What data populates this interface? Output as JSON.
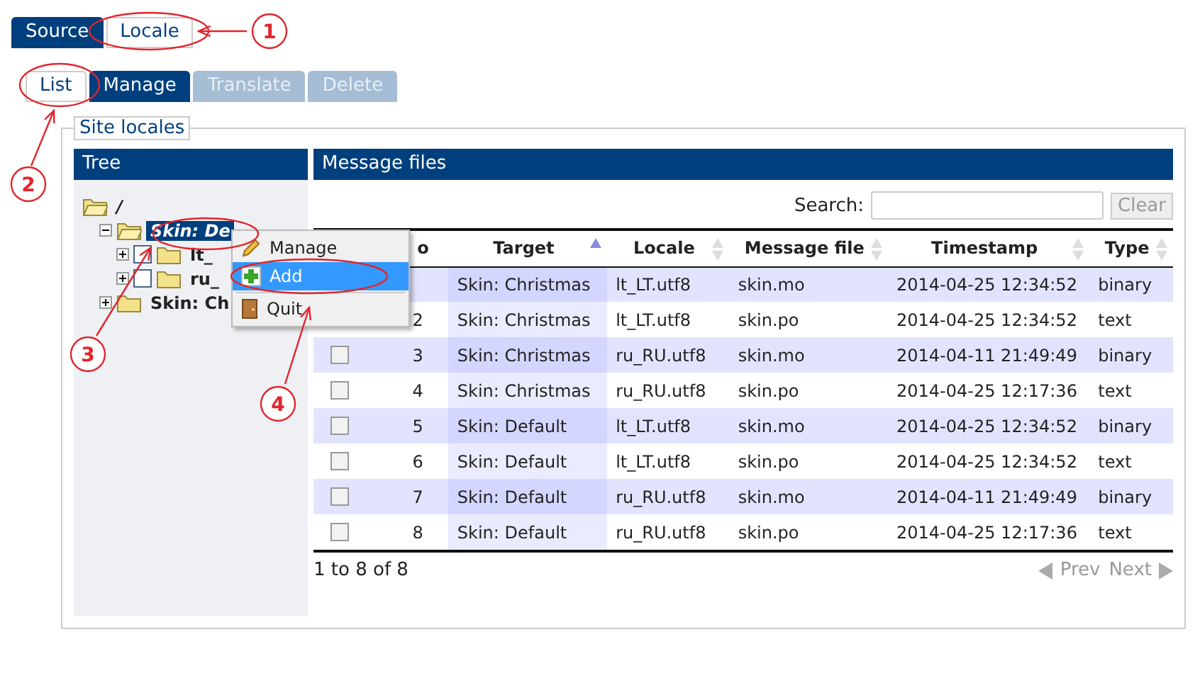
{
  "top_tabs": [
    {
      "label": "Source",
      "selected": false
    },
    {
      "label": "Locale",
      "selected": true
    }
  ],
  "sub_tabs": [
    {
      "label": "List",
      "selected": true,
      "disabled": false
    },
    {
      "label": "Manage",
      "selected": false,
      "disabled": false
    },
    {
      "label": "Translate",
      "selected": false,
      "disabled": true
    },
    {
      "label": "Delete",
      "selected": false,
      "disabled": true
    }
  ],
  "fieldset": {
    "legend": "Site locales"
  },
  "tree": {
    "title": "Tree",
    "nodes": [
      {
        "label": "/",
        "selected": false,
        "children": [
          {
            "label": "Skin: De",
            "expanded": true,
            "selected": true,
            "children": [
              {
                "label": "lt_",
                "expanded": false,
                "selected": false,
                "checked": false
              },
              {
                "label": "ru_",
                "expanded": false,
                "selected": false,
                "checked": false
              }
            ]
          },
          {
            "label": "Skin: Ch",
            "expanded": false,
            "selected": false
          }
        ]
      }
    ]
  },
  "context_menu": [
    {
      "label": "Manage",
      "selected": false
    },
    {
      "label": "Add",
      "selected": true
    },
    {
      "label": "Quit",
      "selected": false
    }
  ],
  "messages": {
    "title": "Message files",
    "search_label": "Search:",
    "clear_button": "Clear",
    "columns": [
      {
        "label": "o"
      },
      {
        "label": "Target",
        "sorted": true
      },
      {
        "label": "Locale",
        "sorted": false
      },
      {
        "label": "Message file",
        "sorted": false
      },
      {
        "label": "Timestamp",
        "sorted": false
      },
      {
        "label": "Type",
        "sorted": false
      }
    ],
    "rows": [
      {
        "cells": [
          "",
          "Skin: Christmas",
          "lt_LT.utf8",
          "skin.mo",
          "2014-04-25 12:34:52",
          "binary"
        ]
      },
      {
        "cells": [
          "2",
          "Skin: Christmas",
          "lt_LT.utf8",
          "skin.po",
          "2014-04-25 12:34:52",
          "text"
        ]
      },
      {
        "checked": false,
        "cells": [
          "3",
          "Skin: Christmas",
          "ru_RU.utf8",
          "skin.mo",
          "2014-04-11 21:49:49",
          "binary"
        ]
      },
      {
        "checked": false,
        "cells": [
          "4",
          "Skin: Christmas",
          "ru_RU.utf8",
          "skin.po",
          "2014-04-25 12:17:36",
          "text"
        ]
      },
      {
        "checked": false,
        "cells": [
          "5",
          "Skin: Default",
          "lt_LT.utf8",
          "skin.mo",
          "2014-04-25 12:34:52",
          "binary"
        ]
      },
      {
        "checked": false,
        "cells": [
          "6",
          "Skin: Default",
          "lt_LT.utf8",
          "skin.po",
          "2014-04-25 12:34:52",
          "text"
        ]
      },
      {
        "checked": false,
        "cells": [
          "7",
          "Skin: Default",
          "ru_RU.utf8",
          "skin.mo",
          "2014-04-11 21:49:49",
          "binary"
        ]
      },
      {
        "checked": false,
        "cells": [
          "8",
          "Skin: Default",
          "ru_RU.utf8",
          "skin.po",
          "2014-04-25 12:17:36",
          "text"
        ]
      }
    ],
    "summary": "1 to 8 of 8",
    "pager": [
      {
        "label": "Prev",
        "disabled": true
      },
      {
        "label": "Next",
        "disabled": true
      }
    ]
  },
  "callouts": [
    {
      "number": "1"
    },
    {
      "number": "2"
    },
    {
      "number": "3"
    },
    {
      "number": "4"
    }
  ]
}
